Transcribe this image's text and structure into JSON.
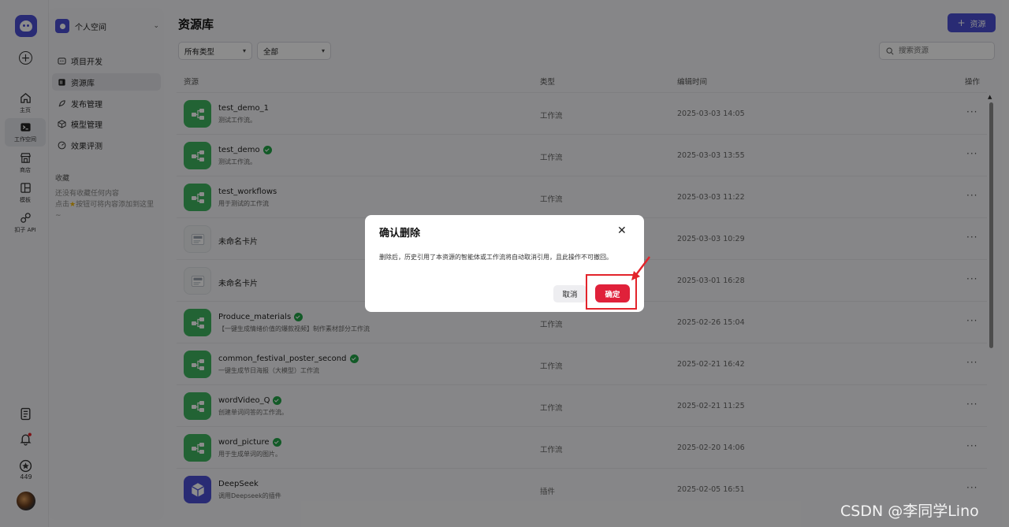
{
  "rail": {
    "items": [
      {
        "label": "主页",
        "icon": "home-icon"
      },
      {
        "label": "工作空间",
        "icon": "terminal-icon"
      },
      {
        "label": "商店",
        "icon": "store-icon"
      },
      {
        "label": "模板",
        "icon": "template-icon"
      },
      {
        "label": "扣子 API",
        "icon": "api-icon"
      }
    ],
    "favorite_count": "449"
  },
  "sidebar": {
    "space_name": "个人空间",
    "items": [
      {
        "label": "项目开发"
      },
      {
        "label": "资源库"
      },
      {
        "label": "发布管理"
      },
      {
        "label": "模型管理"
      },
      {
        "label": "效果评测"
      }
    ],
    "favorites_title": "收藏",
    "favorites_empty_line1": "还没有收藏任何内容",
    "favorites_empty_line2": "点击",
    "favorites_empty_line3": "按钮可将内容添加到这里~"
  },
  "main": {
    "title": "资源库",
    "add_button": "资源",
    "filter_type": "所有类型",
    "filter_scope": "全部",
    "search_placeholder": "搜索资源",
    "columns": {
      "resource": "资源",
      "type": "类型",
      "edited": "编辑时间",
      "actions": "操作"
    },
    "rows": [
      {
        "name": "test_demo_1",
        "desc": "测试工作流。",
        "type": "工作流",
        "time": "2025-03-03 14:05",
        "kind": "wf",
        "verified": false
      },
      {
        "name": "test_demo",
        "desc": "测试工作流。",
        "type": "工作流",
        "time": "2025-03-03 13:55",
        "kind": "wf",
        "verified": true
      },
      {
        "name": "test_workflows",
        "desc": "用于测试的工作流",
        "type": "工作流",
        "time": "2025-03-03 11:22",
        "kind": "wf",
        "verified": false
      },
      {
        "name": "未命名卡片",
        "desc": "",
        "type": "",
        "time": "2025-03-03 10:29",
        "kind": "card",
        "verified": false
      },
      {
        "name": "未命名卡片",
        "desc": "",
        "type": "",
        "time": "2025-03-01 16:28",
        "kind": "card",
        "verified": false
      },
      {
        "name": "Produce_materials",
        "desc": "【一键生成情绪价值的爆款视频】制作素材部分工作流",
        "type": "工作流",
        "time": "2025-02-26 15:04",
        "kind": "wf",
        "verified": true
      },
      {
        "name": "common_festival_poster_second",
        "desc": "一键生成节日海报（大模型）工作流",
        "type": "工作流",
        "time": "2025-02-21 16:42",
        "kind": "wf",
        "verified": true
      },
      {
        "name": "wordVideo_Q",
        "desc": "创建单词问答的工作流。",
        "type": "工作流",
        "time": "2025-02-21 11:25",
        "kind": "wf",
        "verified": true
      },
      {
        "name": "word_picture",
        "desc": "用于生成单词的图片。",
        "type": "工作流",
        "time": "2025-02-20 14:06",
        "kind": "wf",
        "verified": true
      },
      {
        "name": "DeepSeek",
        "desc": "调用Deepseek的插件",
        "type": "插件",
        "time": "2025-02-05 16:51",
        "kind": "plug",
        "verified": false
      }
    ]
  },
  "modal": {
    "title": "确认删除",
    "message": "删除后，历史引用了本资源的智能体或工作流将自动取消引用，且此操作不可撤回。",
    "cancel": "取消",
    "confirm": "确定"
  },
  "watermark": "CSDN @李同学Lino",
  "colors": {
    "accent": "#4c4fd4",
    "workflow": "#3fb560",
    "danger": "#e0213a"
  }
}
